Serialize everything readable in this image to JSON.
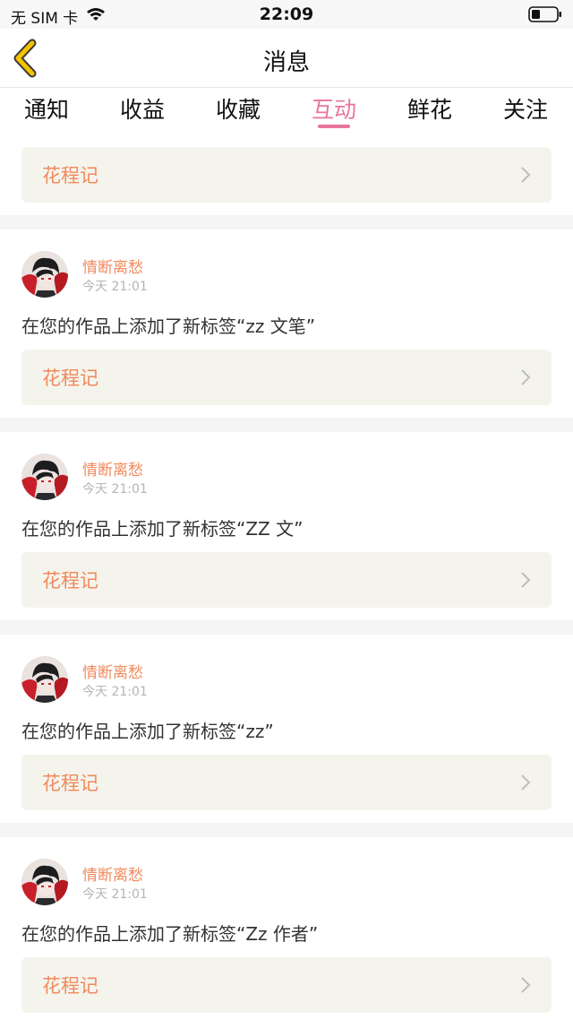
{
  "status_bar": {
    "carrier": "无 SIM 卡",
    "time": "22:09",
    "wifi_icon": "wifi-icon",
    "battery_icon": "battery-icon"
  },
  "nav": {
    "title": "消息",
    "back_icon": "back-chevron-icon",
    "accent_color": "#f5c400"
  },
  "tabs": [
    {
      "label": "通知",
      "active": false
    },
    {
      "label": "收益",
      "active": false
    },
    {
      "label": "收藏",
      "active": false
    },
    {
      "label": "互动",
      "active": true
    },
    {
      "label": "鲜花",
      "active": false
    },
    {
      "label": "关注",
      "active": false
    }
  ],
  "active_tab_color": "#e8759d",
  "first_card": {
    "book": "花程记"
  },
  "messages": [
    {
      "user": "情断离愁",
      "time": "今天 21:01",
      "text": "在您的作品上添加了新标签“zz 文笔”",
      "book": "花程记"
    },
    {
      "user": "情断离愁",
      "time": "今天 21:01",
      "text": "在您的作品上添加了新标签“ZZ 文”",
      "book": "花程记"
    },
    {
      "user": "情断离愁",
      "time": "今天 21:01",
      "text": "在您的作品上添加了新标签“zz”",
      "book": "花程记"
    },
    {
      "user": "情断离愁",
      "time": "今天 21:01",
      "text": "在您的作品上添加了新标签“Zz 作者”",
      "book": "花程记"
    }
  ],
  "colors": {
    "name_color": "#f08a5d",
    "book_card_bg": "#f5f4ec"
  }
}
